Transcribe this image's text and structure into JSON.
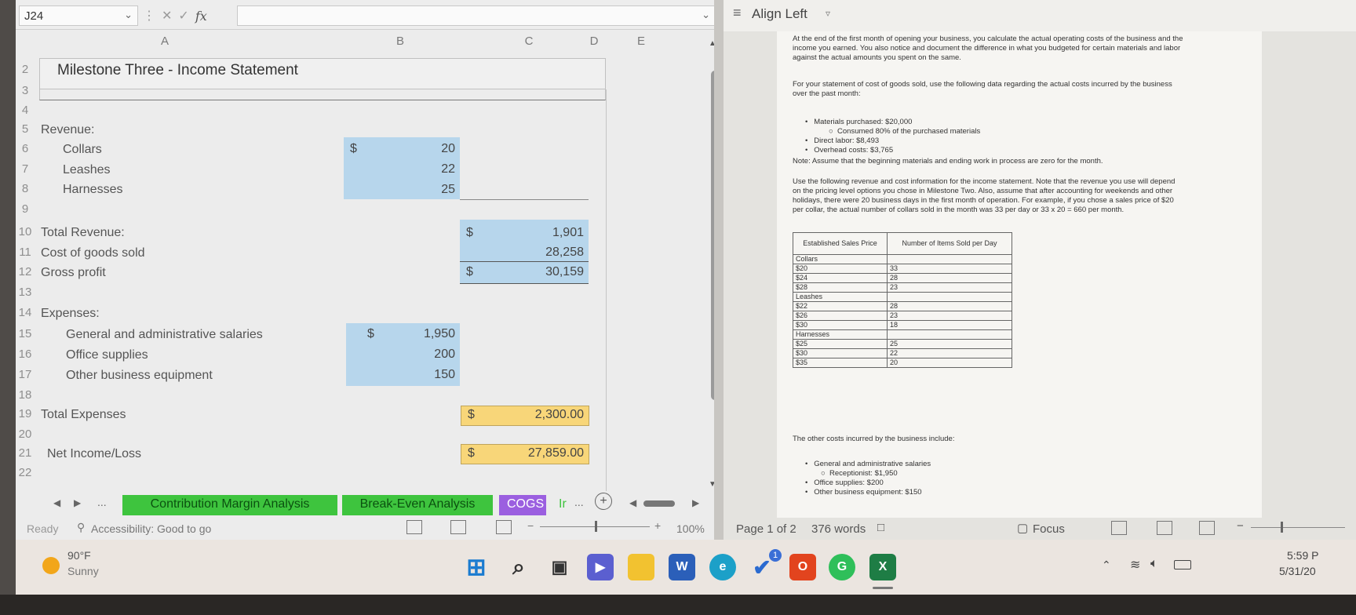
{
  "excel": {
    "namebox": "J24",
    "columns": [
      "A",
      "B",
      "C",
      "D",
      "E"
    ],
    "sheet_title": "Milestone Three - Income Statement",
    "rows": [
      "2",
      "3",
      "4",
      "5",
      "6",
      "7",
      "8",
      "9",
      "10",
      "11",
      "12",
      "13",
      "14",
      "15",
      "16",
      "17",
      "18",
      "19",
      "20",
      "21",
      "22"
    ],
    "labels": {
      "revenue": "Revenue:",
      "collars": "Collars",
      "leashes": "Leashes",
      "harnesses": "Harnesses",
      "total_revenue": "Total Revenue:",
      "cogs": "Cost of goods sold",
      "gross_profit": "Gross profit",
      "expenses": "Expenses:",
      "ga_salaries": "General and administrative salaries",
      "office_supplies": "Office supplies",
      "other_equipment": "Other business equipment",
      "total_expenses": "Total Expenses",
      "net_income": "Net Income/Loss"
    },
    "currency": "$",
    "values": {
      "collars": "20",
      "leashes": "22",
      "harnesses": "25",
      "total_revenue": "1,901",
      "cogs": "28,258",
      "gross_profit": "30,159",
      "ga_salaries": "1,950",
      "office_supplies": "200",
      "other_equipment": "150",
      "total_expenses": "2,300.00",
      "net_income": "27,859.00"
    },
    "tabs": [
      "Contribution Margin Analysis",
      "Break-Even Analysis",
      "COGS",
      "Ir"
    ],
    "tab_more": "...",
    "status": {
      "ready": "Ready",
      "accessibility": "Accessibility: Good to go",
      "zoom": "100%"
    }
  },
  "word": {
    "toolbar_label": "Align Left",
    "para1": "At the end of the first month of opening your business, you calculate the actual operating costs of the business and the income you earned. You also notice and document the difference in what you budgeted for certain materials and labor against the actual amounts you spent on the same.",
    "para2": "For your statement of cost of goods sold, use the following data regarding the actual costs incurred by the business over the past month:",
    "bullets1": [
      "Materials purchased: $20,000",
      "Consumed 80% of the purchased materials",
      "Direct labor: $8,493",
      "Overhead costs: $3,765"
    ],
    "note": "Note: Assume that the beginning materials and ending work in process are zero for the month.",
    "para3": "Use the following revenue and cost information for the income statement. Note that the revenue you use will depend on the pricing level options you chose in Milestone Two. Also, assume that after accounting for weekends and other holidays, there were 20 business days in the first month of operation. For example, if you chose a sales price of $20 per collar, the actual number of collars sold in the month was 33 per day or 33 x 20 = 660 per month.",
    "table_headers": [
      "Established Sales Price",
      "Number of Items Sold per Day"
    ],
    "table_rows": [
      [
        "Collars",
        ""
      ],
      [
        "$20",
        "33"
      ],
      [
        "$24",
        "28"
      ],
      [
        "$28",
        "23"
      ],
      [
        "Leashes",
        ""
      ],
      [
        "$22",
        "28"
      ],
      [
        "$26",
        "23"
      ],
      [
        "$30",
        "18"
      ],
      [
        "Harnesses",
        ""
      ],
      [
        "$25",
        "25"
      ],
      [
        "$30",
        "22"
      ],
      [
        "$35",
        "20"
      ]
    ],
    "para4": "The other costs incurred by the business include:",
    "bullets2": [
      "General and administrative salaries",
      "Receptionist: $1,950",
      "Office supplies: $200",
      "Other business equipment: $150"
    ],
    "status": {
      "page": "Page 1 of 2",
      "words": "376 words",
      "focus": "Focus"
    }
  },
  "taskbar": {
    "weather_temp": "90°F",
    "weather_desc": "Sunny",
    "time": "5:59 P",
    "date": "5/31/20",
    "badge": "1"
  },
  "colors": {
    "blue_cell": "#b7d6ec",
    "yellow_cell": "#f8d679",
    "tab_green": "#3ec43e",
    "tab_purple": "#9b5fe0"
  }
}
